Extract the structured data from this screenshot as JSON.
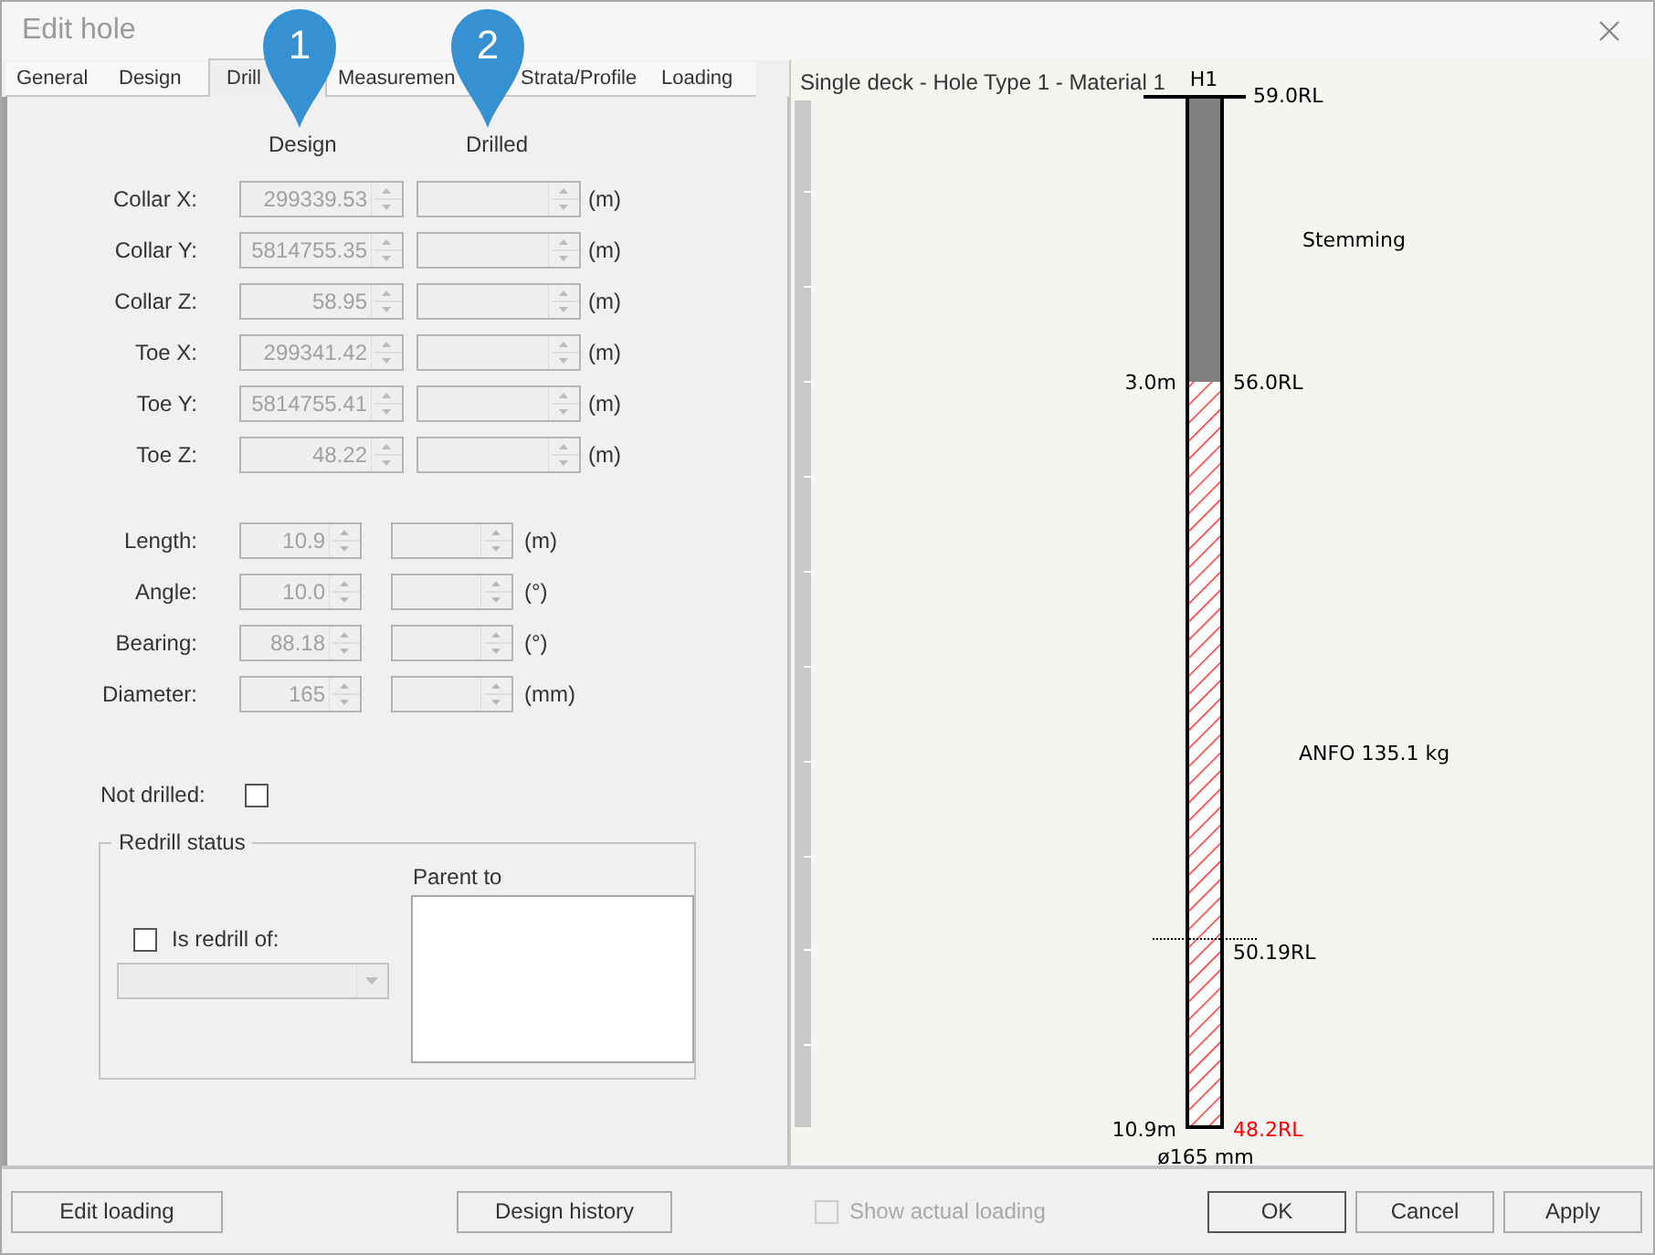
{
  "window": {
    "title": "Edit hole"
  },
  "tabs": [
    {
      "label": "General",
      "selected": false
    },
    {
      "label": "Design",
      "selected": false
    },
    {
      "label": "Drill",
      "selected": true
    },
    {
      "label": "Measuremen",
      "selected": false
    },
    {
      "label": "Strata/Profile",
      "selected": false
    },
    {
      "label": "Loading",
      "selected": false
    }
  ],
  "callouts": [
    "1",
    "2"
  ],
  "form": {
    "disabled": true,
    "column_headers": [
      "Design",
      "Drilled"
    ],
    "coordinates": [
      {
        "label": "Collar X:",
        "design": "299339.53",
        "unit": "(m)"
      },
      {
        "label": "Collar Y:",
        "design": "5814755.35",
        "unit": "(m)"
      },
      {
        "label": "Collar Z:",
        "design": "58.95",
        "unit": "(m)"
      },
      {
        "label": "Toe X:",
        "design": "299341.42",
        "unit": "(m)"
      },
      {
        "label": "Toe Y:",
        "design": "5814755.41",
        "unit": "(m)"
      },
      {
        "label": "Toe Z:",
        "design": "48.22",
        "unit": "(m)"
      }
    ],
    "geometry": [
      {
        "label": "Length:",
        "design": "10.9",
        "unit": "(m)"
      },
      {
        "label": "Angle:",
        "design": "10.0",
        "unit": "(°)"
      },
      {
        "label": "Bearing:",
        "design": "88.18",
        "unit": "(°)"
      },
      {
        "label": "Diameter:",
        "design": "165",
        "unit": "(mm)"
      }
    ],
    "not_drilled": {
      "label": "Not drilled:",
      "checked": false
    },
    "redrill": {
      "title": "Redrill status",
      "is_redrill": {
        "label": "Is redrill of:",
        "checked": false
      },
      "parent_to_label": "Parent to"
    }
  },
  "profile": {
    "title": "Single deck - Hole Type 1 - Material 1",
    "hole_name": "H1",
    "decks": [
      {
        "kind": "stemming",
        "label": "Stemming"
      },
      {
        "kind": "explosive",
        "label": "ANFO 135.1 kg"
      }
    ],
    "top_rl": "59.0RL",
    "boundary_depth": "3.0m",
    "boundary_rl": "56.0RL",
    "marker_rl": "50.19RL",
    "bottom_depth": "10.9m",
    "bottom_rl": {
      "text": "48.2RL",
      "warning": true
    },
    "diameter": "ø165 mm"
  },
  "bottom_left_buttons": [
    "Edit loading",
    "Design history"
  ],
  "show_actual_loading": {
    "label": "Show actual loading",
    "checked": false,
    "disabled": true
  },
  "dialog_buttons": [
    {
      "label": "OK",
      "default": true
    },
    {
      "label": "Cancel",
      "default": false
    },
    {
      "label": "Apply",
      "default": false
    }
  ]
}
